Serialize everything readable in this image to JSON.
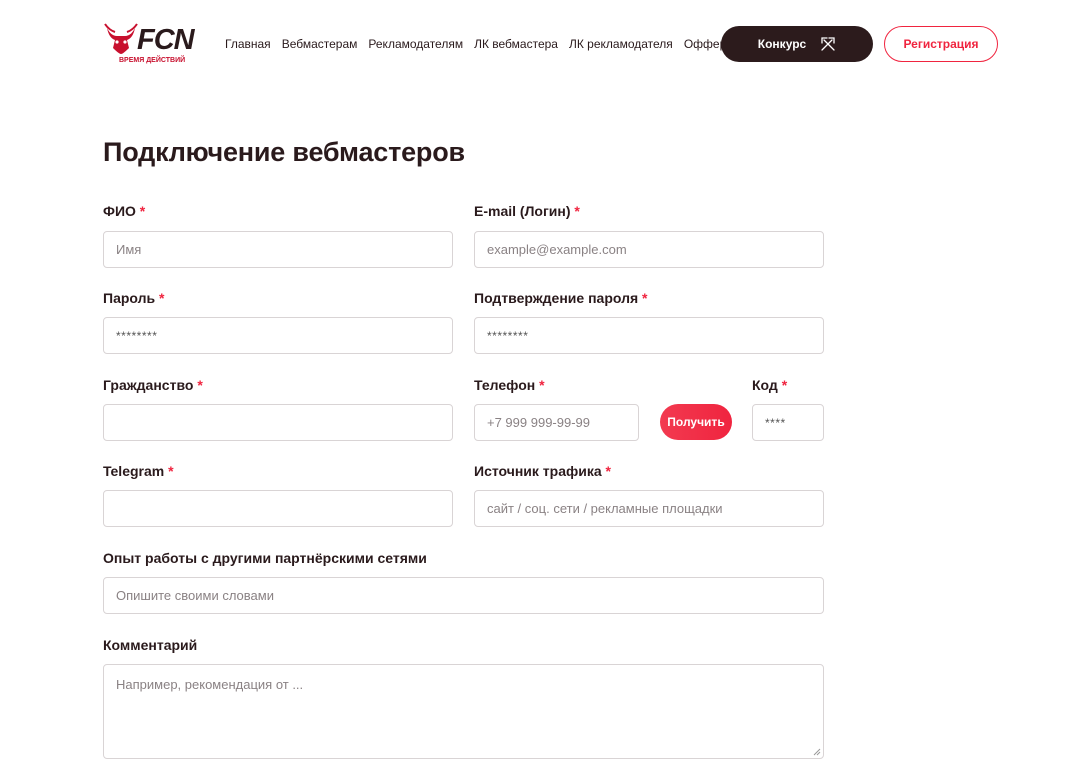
{
  "header": {
    "logo_text": "FCN",
    "logo_subtitle": "ВРЕМЯ ДЕЙСТВИЙ",
    "nav": [
      "Главная",
      "Вебмастерам",
      "Рекламодателям",
      "ЛК вебмастера",
      "ЛК рекламодателя",
      "Офферы"
    ],
    "contest_label": "Конкурс",
    "register_label": "Регистрация"
  },
  "page": {
    "title": "Подключение вебмастеров"
  },
  "form": {
    "required_mark": "*",
    "fio": {
      "label": "ФИО",
      "placeholder": "Имя"
    },
    "email": {
      "label": "E-mail (Логин)",
      "placeholder": "example@example.com"
    },
    "password": {
      "label": "Пароль",
      "value": "********"
    },
    "password_confirm": {
      "label": "Подтверждение пароля",
      "value": "********"
    },
    "citizenship": {
      "label": "Гражданство",
      "placeholder": ""
    },
    "phone": {
      "label": "Телефон",
      "placeholder": "+7 999 999-99-99",
      "get_button": "Получить"
    },
    "code": {
      "label": "Код",
      "value": "****"
    },
    "telegram": {
      "label": "Telegram",
      "placeholder": ""
    },
    "traffic_source": {
      "label": "Источник трафика",
      "placeholder": "сайт / соц. сети / рекламные площадки"
    },
    "experience": {
      "label": "Опыт работы с другими партнёрскими сетями",
      "placeholder": "Опишите своими словами"
    },
    "comment": {
      "label": "Комментарий",
      "placeholder": "Например, рекомендация от ..."
    }
  },
  "colors": {
    "accent": "#f0243f",
    "dark": "#2c1b1c"
  }
}
